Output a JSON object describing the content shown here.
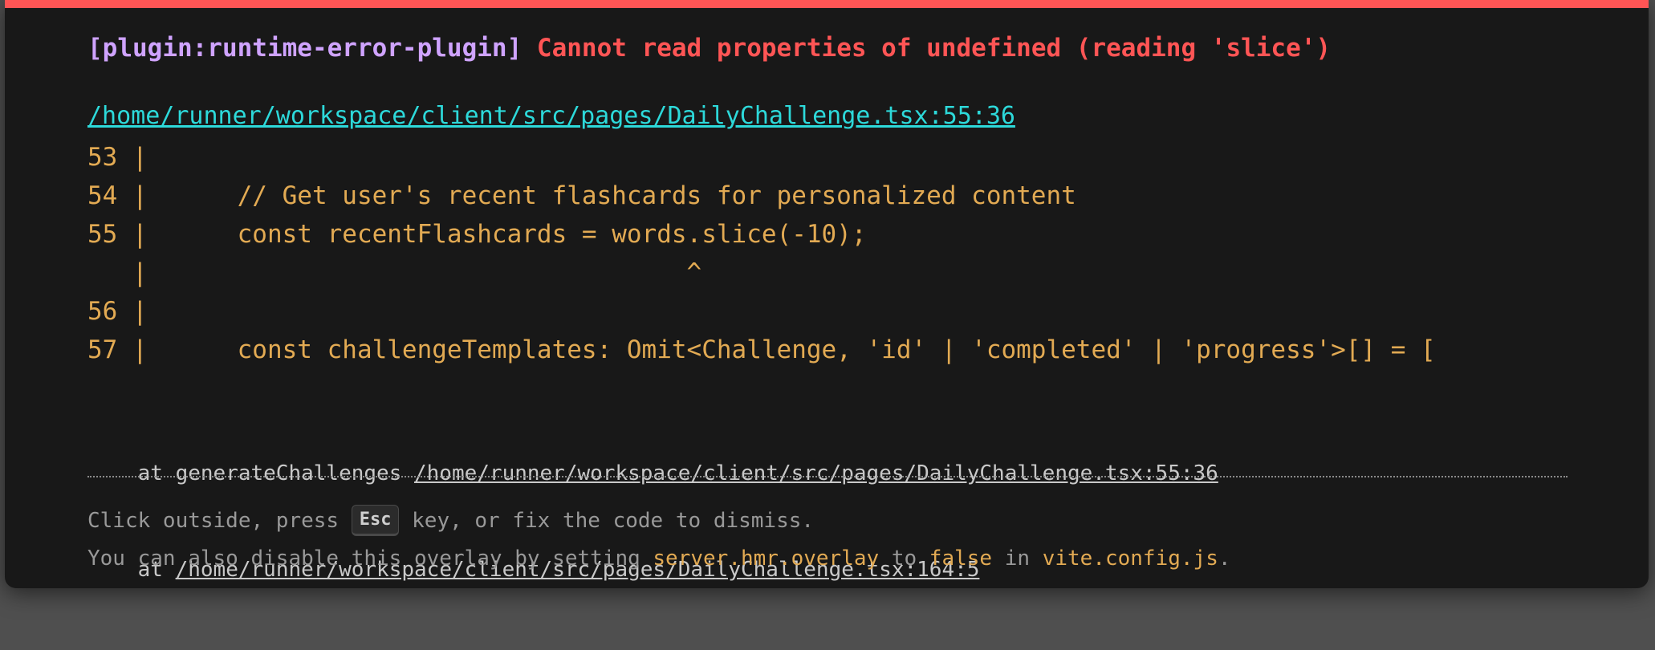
{
  "error": {
    "plugin": "[plugin:runtime-error-plugin]",
    "message": "Cannot read properties of undefined (reading 'slice')",
    "file": "/home/runner/workspace/client/src/pages/DailyChallenge.tsx:55:36"
  },
  "frame": [
    "53 |",
    "54 |      // Get user's recent flashcards for personalized content",
    "55 |      const recentFlashcards = words.slice(-10);",
    "   |                                    ^",
    "56 |",
    "57 |      const challengeTemplates: Omit<Challenge, 'id' | 'completed' | 'progress'>[] = ["
  ],
  "stack": [
    {
      "prefix": "at generateChallenges ",
      "link": "/home/runner/workspace/client/src/pages/DailyChallenge.tsx:55:36"
    },
    {
      "prefix": "at ",
      "link": "/home/runner/workspace/client/src/pages/DailyChallenge.tsx:164:5"
    }
  ],
  "tip": {
    "line1_before": "Click outside, press ",
    "key": "Esc",
    "line1_after": " key, or fix the code to dismiss.",
    "line2_a": "You can also disable this overlay by setting ",
    "line2_code1": "server.hmr.overlay",
    "line2_b": " to ",
    "line2_code2": "false",
    "line2_c": " in ",
    "line2_code3": "vite.config.js",
    "line2_d": "."
  },
  "colors": {
    "accent_border": "#ff5555",
    "plugin": "#cfa3ff",
    "message": "#ff5555",
    "file_link": "#2dd9da",
    "code": "#e2aa53",
    "background": "#181818"
  }
}
